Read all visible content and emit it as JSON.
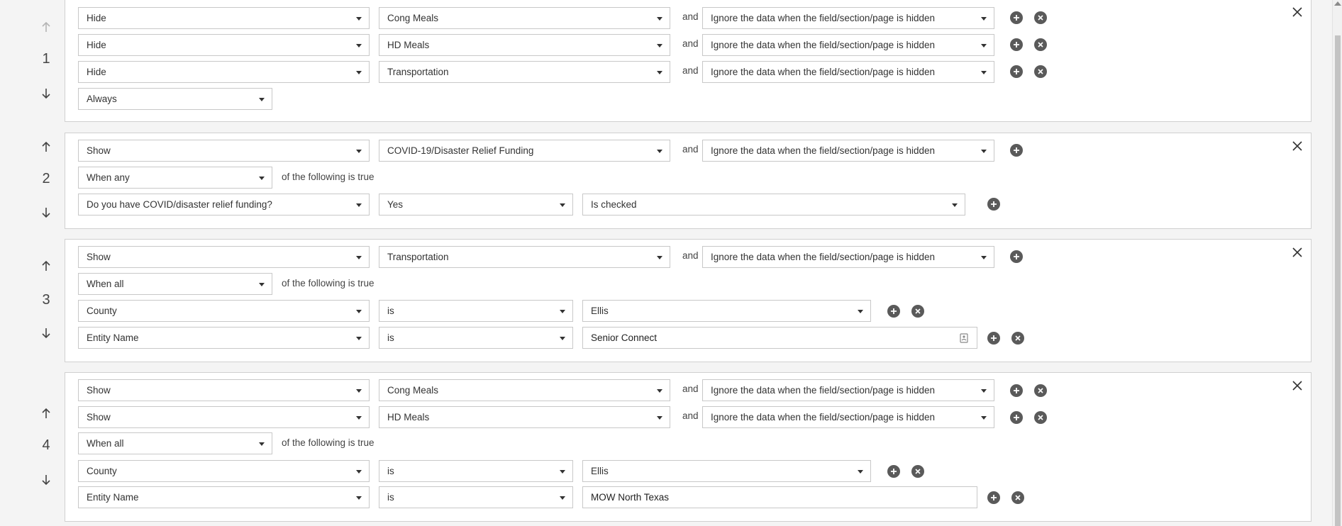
{
  "labels": {
    "and": "and",
    "of_following": "of the following is true"
  },
  "rules": [
    {
      "number": "1",
      "actions": [
        {
          "action": "Hide",
          "target": "Cong Meals",
          "behavior": "Ignore the data when the field/section/page is hidden"
        },
        {
          "action": "Hide",
          "target": "HD Meals",
          "behavior": "Ignore the data when the field/section/page is hidden"
        },
        {
          "action": "Hide",
          "target": "Transportation",
          "behavior": "Ignore the data when the field/section/page is hidden"
        }
      ],
      "condition_mode": "Always"
    },
    {
      "number": "2",
      "actions": [
        {
          "action": "Show",
          "target": "COVID-19/Disaster Relief Funding",
          "behavior": "Ignore the data when the field/section/page is hidden"
        }
      ],
      "condition_mode": "When any",
      "conditions": [
        {
          "field": "Do you have COVID/disaster relief funding?",
          "operator": "Yes",
          "value": "Is checked"
        }
      ]
    },
    {
      "number": "3",
      "actions": [
        {
          "action": "Show",
          "target": "Transportation",
          "behavior": "Ignore the data when the field/section/page is hidden"
        }
      ],
      "condition_mode": "When all",
      "conditions": [
        {
          "field": "County",
          "operator": "is",
          "value": "Ellis"
        },
        {
          "field": "Entity Name",
          "operator": "is",
          "value": "Senior Connect"
        }
      ]
    },
    {
      "number": "4",
      "actions": [
        {
          "action": "Show",
          "target": "Cong Meals",
          "behavior": "Ignore the data when the field/section/page is hidden"
        },
        {
          "action": "Show",
          "target": "HD Meals",
          "behavior": "Ignore the data when the field/section/page is hidden"
        }
      ],
      "condition_mode": "When all",
      "conditions": [
        {
          "field": "County",
          "operator": "is",
          "value": "Ellis"
        },
        {
          "field": "Entity Name",
          "operator": "is",
          "value": "MOW North Texas"
        }
      ]
    }
  ],
  "colors": {
    "accent": "#2ba56a",
    "icon_button": "#5a5a5a",
    "border": "#c8c8c8"
  },
  "icons": {
    "move_up": "arrow-up-icon",
    "move_down": "arrow-down-icon",
    "remove_rule": "close-icon",
    "add": "plus-circle-icon",
    "remove": "x-circle-icon",
    "context": "contact-card-icon"
  }
}
